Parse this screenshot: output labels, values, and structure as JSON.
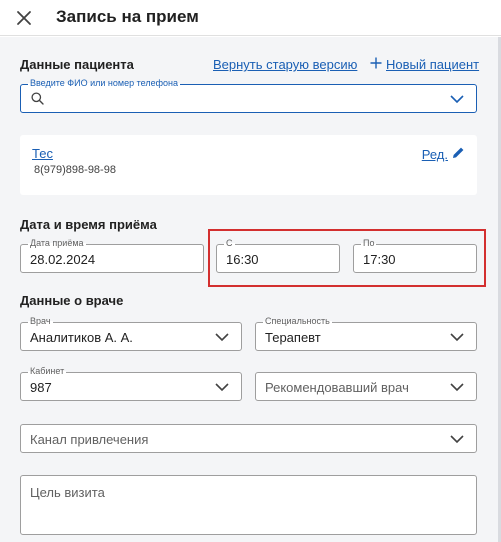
{
  "header": {
    "title": "Запись на прием"
  },
  "patient": {
    "section_title": "Данные пациента",
    "revert_link": "Вернуть старую версию",
    "new_patient_link": "Новый пациент",
    "search_label": "Введите ФИО или номер телефона",
    "card": {
      "name": "Тес",
      "phone": "8(979)898-98-98",
      "edit_label": "Ред."
    }
  },
  "datetime": {
    "section_title": "Дата и время приёма",
    "date_label": "Дата приёма",
    "date_value": "28.02.2024",
    "from_label": "С",
    "from_value": "16:30",
    "to_label": "По",
    "to_value": "17:30"
  },
  "doctor": {
    "section_title": "Данные о враче",
    "doctor_label": "Врач",
    "doctor_value": "Аналитиков А. А.",
    "specialty_label": "Специальность",
    "specialty_value": "Терапевт",
    "cabinet_label": "Кабинет",
    "cabinet_value": "987",
    "referring_placeholder": "Рекомендовавший врач",
    "channel_placeholder": "Канал привлечения",
    "visit_purpose_placeholder": "Цель визита"
  },
  "colors": {
    "accent": "#1a5fb4",
    "highlight": "#d32f2f",
    "panel_bg": "#f4f5f7"
  }
}
